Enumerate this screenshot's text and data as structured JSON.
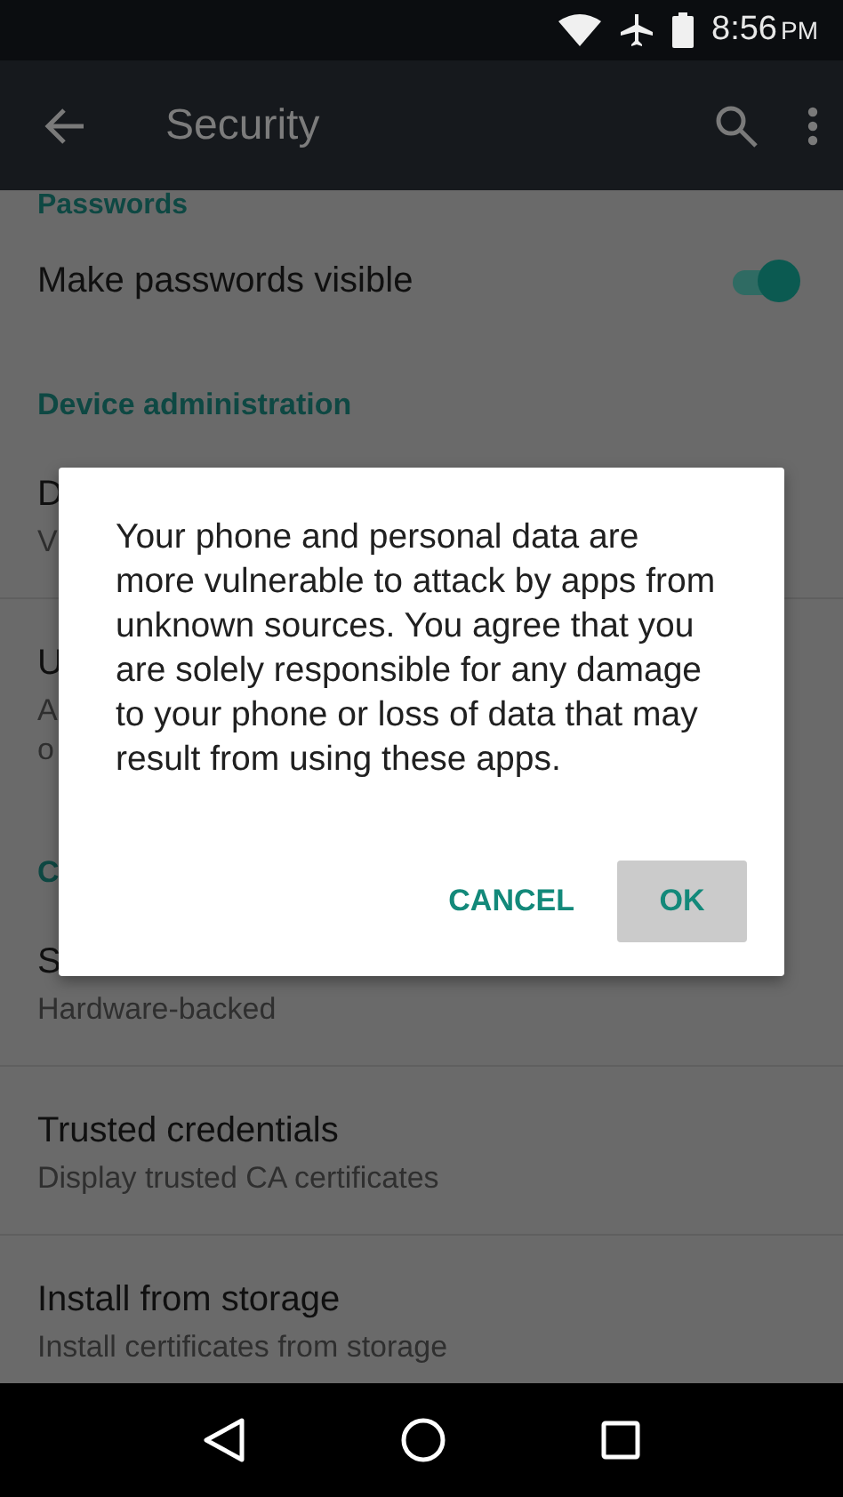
{
  "status_bar": {
    "time": "8:56",
    "meridiem": "PM"
  },
  "app_bar": {
    "title": "Security"
  },
  "list": [
    {
      "kind": "header",
      "title": "Passwords"
    },
    {
      "kind": "switch",
      "title": "Make passwords visible",
      "on": true
    },
    {
      "kind": "header",
      "title": "Device administration"
    },
    {
      "kind": "row",
      "title": "D",
      "summary_lines": [
        "V"
      ]
    },
    {
      "kind": "row",
      "title": "U",
      "summary_lines": [
        "A",
        "o"
      ]
    },
    {
      "kind": "header",
      "title": "C"
    },
    {
      "kind": "row",
      "title": "S",
      "summary_lines": [
        "Hardware-backed"
      ]
    },
    {
      "kind": "row",
      "title": "Trusted credentials",
      "summary_lines": [
        "Display trusted CA certificates"
      ]
    },
    {
      "kind": "row",
      "title": "Install from storage",
      "summary_lines": [
        "Install certificates from storage"
      ]
    }
  ],
  "dialog": {
    "message": "Your phone and personal data are more vulnerable to attack by apps from unknown sources. You agree that you are solely responsible for any damage to your phone or loss of data that may result from using these apps.",
    "buttons": [
      {
        "label": "CANCEL",
        "pressed": false
      },
      {
        "label": "OK",
        "pressed": true
      }
    ]
  }
}
